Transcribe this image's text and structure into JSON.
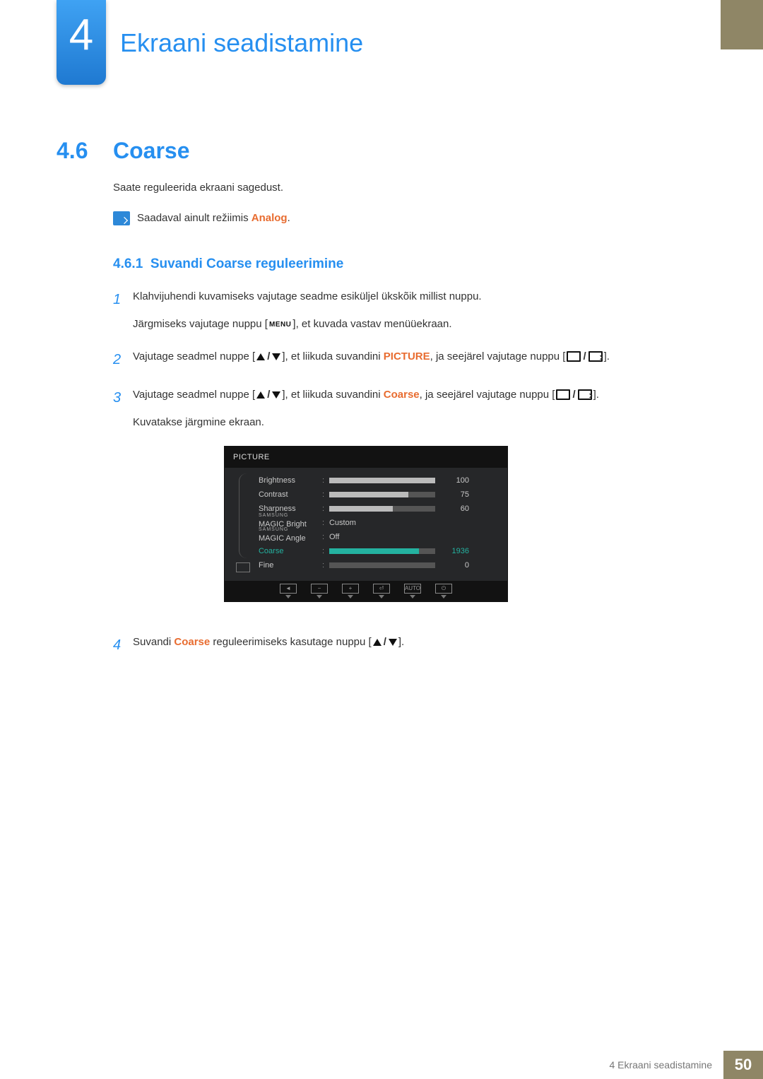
{
  "chapter": {
    "number": "4",
    "title": "Ekraani seadistamine"
  },
  "section": {
    "number": "4.6",
    "title": "Coarse"
  },
  "intro": "Saate reguleerida ekraani sagedust.",
  "note": {
    "prefix": "Saadaval ainult režiimis ",
    "mode": "Analog",
    "suffix": "."
  },
  "subsection": {
    "number": "4.6.1",
    "title": "Suvandi Coarse reguleerimine"
  },
  "steps": {
    "s1a": "Klahvijuhendi kuvamiseks vajutage seadme esiküljel ükskõik millist nuppu.",
    "s1b_pre": "Järgmiseks vajutage nuppu [",
    "s1b_menu": "MENU",
    "s1b_post": "], et kuvada vastav menüüekraan.",
    "s2_pre": "Vajutage seadmel nuppe [",
    "s2_mid": "], et liikuda suvandini ",
    "s2_target": "PICTURE",
    "s2_post": ", ja seejärel vajutage nuppu [",
    "s2_end": "].",
    "s3_pre": "Vajutage seadmel nuppe [",
    "s3_mid": "], et liikuda suvandini ",
    "s3_target": "Coarse",
    "s3_post": ", ja seejärel vajutage nuppu [",
    "s3_end": "].",
    "s3_line2": "Kuvatakse järgmine ekraan.",
    "s4_pre": "Suvandi ",
    "s4_target": "Coarse",
    "s4_mid": " reguleerimiseks kasutage nuppu [",
    "s4_end": "]."
  },
  "osd": {
    "title": "PICTURE",
    "rows": [
      {
        "label": "Brightness",
        "value": "100",
        "pct": 100
      },
      {
        "label": "Contrast",
        "value": "75",
        "pct": 75
      },
      {
        "label": "Sharpness",
        "value": "60",
        "pct": 60
      },
      {
        "label_small": "SAMSUNG",
        "label": "MAGIC",
        "suffix": "Bright",
        "text": "Custom"
      },
      {
        "label_small": "SAMSUNG",
        "label": "MAGIC",
        "suffix": "Angle",
        "text": "Off"
      },
      {
        "label": "Coarse",
        "value": "1936",
        "pct": 85,
        "selected": true
      },
      {
        "label": "Fine",
        "value": "0",
        "pct": 0
      }
    ],
    "footer": {
      "auto": "AUTO"
    }
  },
  "footer": {
    "text": "4 Ekraani seadistamine",
    "page": "50"
  }
}
